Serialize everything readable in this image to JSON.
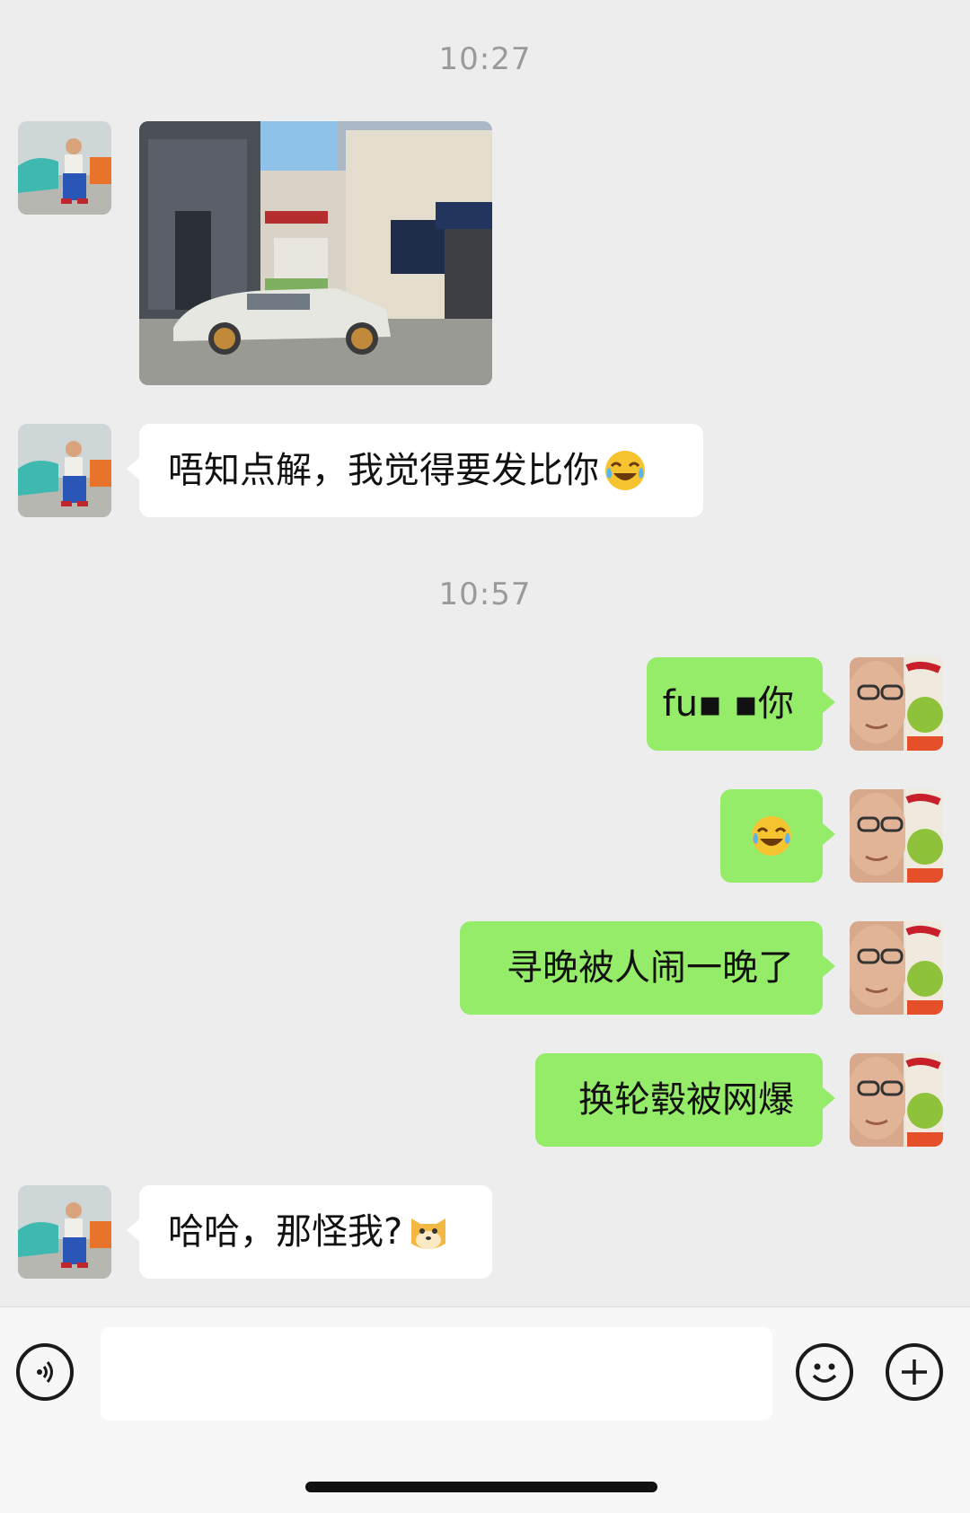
{
  "chat": {
    "timestamps": [
      "10:27",
      "10:57"
    ],
    "messages": [
      {
        "side": "in",
        "type": "image",
        "description_icon": "car-photo"
      },
      {
        "side": "in",
        "type": "text",
        "text": "唔知点解，我觉得要发比你",
        "emoji": "tears-of-joy-emoji"
      },
      {
        "side": "out",
        "type": "text",
        "text": "fu▪ ▪你",
        "emoji": ""
      },
      {
        "side": "out",
        "type": "emoji",
        "text": "",
        "emoji": "tears-of-joy-emoji"
      },
      {
        "side": "out",
        "type": "text",
        "text": "寻晚被人闹一晚了",
        "emoji": ""
      },
      {
        "side": "out",
        "type": "text",
        "text": "换轮毂被网爆",
        "emoji": ""
      },
      {
        "side": "in",
        "type": "text",
        "text": "哈哈，那怪我?",
        "emoji": "doge-emoji"
      }
    ]
  },
  "input_bar": {
    "voice_icon": "voice-icon",
    "emoji_icon": "smiley-icon",
    "add_icon": "plus-icon",
    "input_value": ""
  },
  "colors": {
    "background": "#ededed",
    "incoming_bubble": "#ffffff",
    "outgoing_bubble": "#95ec69",
    "timestamp": "#9a9a9a"
  }
}
